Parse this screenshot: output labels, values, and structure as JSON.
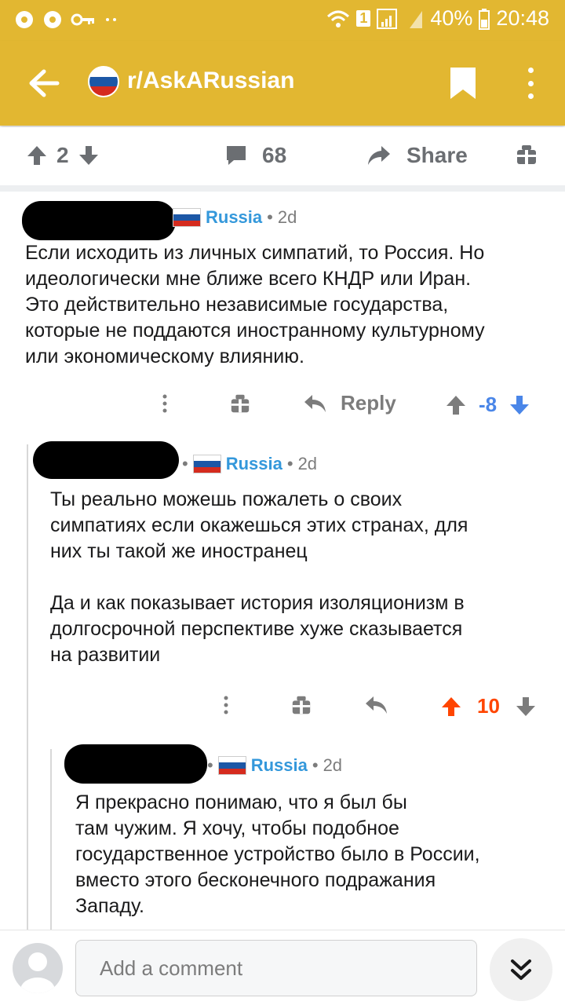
{
  "status_bar": {
    "battery": "40%",
    "time": "20:48",
    "sim_badge": "1"
  },
  "app_bar": {
    "subreddit": "r/AskARussian"
  },
  "post_bar": {
    "score": "2",
    "comments": "68",
    "share": "Share"
  },
  "comments": [
    {
      "flair": "Russia",
      "sep": "•",
      "age": "2d",
      "lines": [
        "Если исходить из личных симпатий, то Россия. Но",
        "идеологически мне ближе всего КНДР или Иран.",
        "Это действительно независимые государства,",
        "которые не поддаются иностранному культурному",
        "или экономическому влиянию."
      ],
      "reply_label": "Reply",
      "score": "-8"
    },
    {
      "flair": "Russia",
      "sep": "•",
      "age": "2d",
      "lines": [
        "Ты реально можешь пожалеть о своих",
        "симпатиях если окажешься этих странах, для",
        "них ты такой же иностранец",
        "",
        "Да и как показывает история изоляционизм в",
        "долгосрочной перспективе хуже сказывается",
        "на развитии"
      ],
      "score": "10"
    },
    {
      "flair": "Russia",
      "sep": "•",
      "age": "2d",
      "lines": [
        "Я прекрасно понимаю, что я был бы",
        "там чужим. Я хочу, чтобы подобное",
        "государственное устройство было в России,",
        "вместо этого бесконечного подражания",
        "Западу."
      ]
    }
  ],
  "composer": {
    "placeholder": "Add a comment"
  },
  "colors": {
    "accent": "#e2b731",
    "flair": "#3498db",
    "upvoted": "#ff4500",
    "downvoted": "#4a86e8",
    "downvote_score": "#4a86e8"
  }
}
